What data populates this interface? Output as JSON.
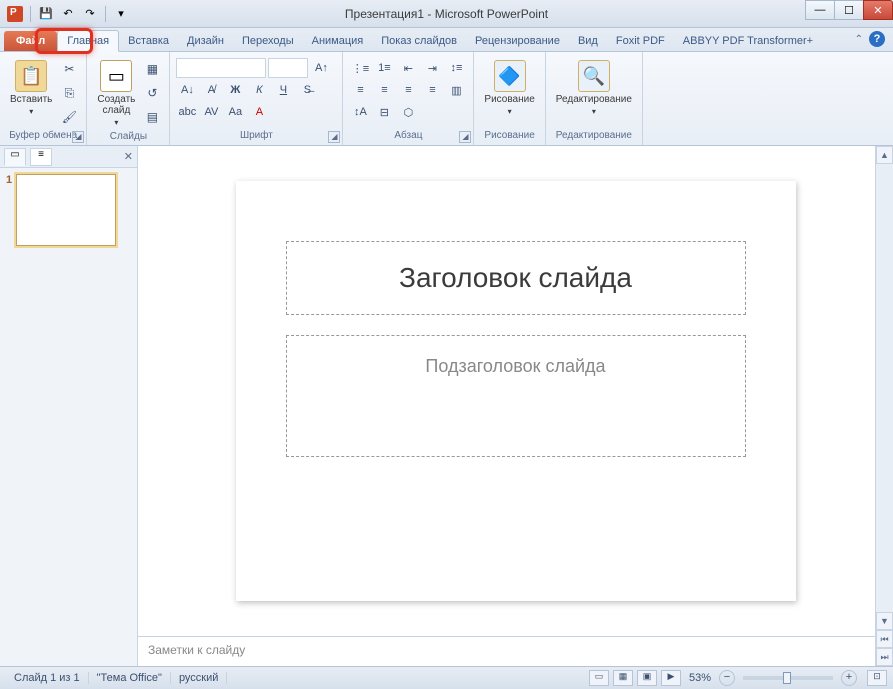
{
  "window": {
    "title": "Презентация1 - Microsoft PowerPoint"
  },
  "tabs": {
    "file": "Файл",
    "home": "Главная",
    "insert": "Вставка",
    "design": "Дизайн",
    "transitions": "Переходы",
    "animation": "Анимация",
    "slideshow": "Показ слайдов",
    "review": "Рецензирование",
    "view": "Вид",
    "foxit": "Foxit PDF",
    "abbyy": "ABBYY PDF Transformer+"
  },
  "ribbon": {
    "clipboard": {
      "label": "Буфер обмена",
      "paste": "Вставить"
    },
    "slides": {
      "label": "Слайды",
      "newslide": "Создать\nслайд"
    },
    "font": {
      "label": "Шрифт"
    },
    "paragraph": {
      "label": "Абзац"
    },
    "drawing": {
      "label": "Рисование",
      "btn": "Рисование"
    },
    "editing": {
      "label": "Редактирование",
      "btn": "Редактирование"
    }
  },
  "pane": {
    "thumb_num": "1"
  },
  "slide": {
    "title_placeholder": "Заголовок слайда",
    "subtitle_placeholder": "Подзаголовок слайда"
  },
  "notes": {
    "placeholder": "Заметки к слайду"
  },
  "status": {
    "slide": "Слайд 1 из 1",
    "theme": "\"Тема Office\"",
    "lang": "русский",
    "zoom": "53%"
  }
}
